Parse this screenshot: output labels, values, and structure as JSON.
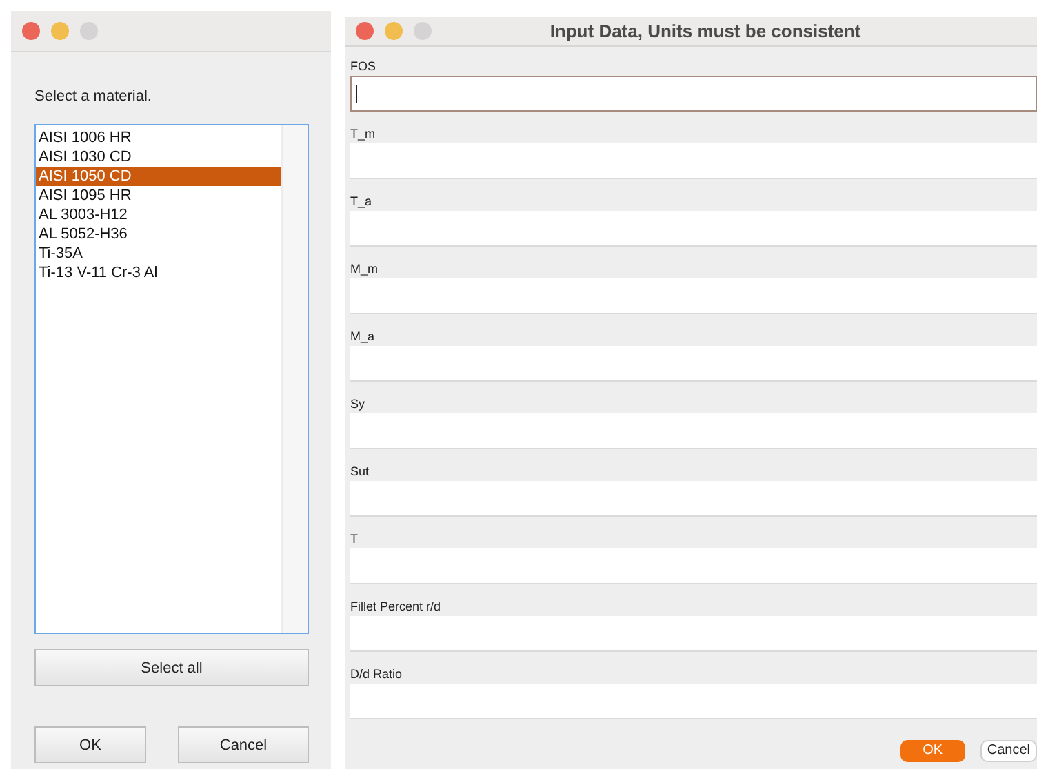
{
  "material_window": {
    "prompt": "Select a material.",
    "materials": [
      {
        "label": "AISI 1006 HR",
        "selected": false
      },
      {
        "label": "AISI 1030 CD",
        "selected": false
      },
      {
        "label": "AISI 1050 CD",
        "selected": true
      },
      {
        "label": "AISI 1095 HR",
        "selected": false
      },
      {
        "label": "AL 3003-H12",
        "selected": false
      },
      {
        "label": "AL 5052-H36",
        "selected": false
      },
      {
        "label": "Ti-35A",
        "selected": false
      },
      {
        "label": "Ti-13 V-11 Cr-3 Al",
        "selected": false
      }
    ],
    "select_all_button": "Select all",
    "buttons": [
      "OK",
      "Cancel"
    ]
  },
  "input_window": {
    "title": "Input Data, Units must be consistent",
    "fields": [
      {
        "label": "FOS",
        "focused": true
      },
      {
        "label": "T_m",
        "focused": false
      },
      {
        "label": "T_a",
        "focused": false
      },
      {
        "label": "M_m",
        "focused": false
      },
      {
        "label": "M_a",
        "focused": false
      },
      {
        "label": "Sy",
        "focused": false
      },
      {
        "label": "Sut",
        "focused": false
      },
      {
        "label": "T",
        "focused": false
      },
      {
        "label": "Fillet Percent r/d",
        "focused": false
      },
      {
        "label": "D/d Ratio",
        "focused": false
      }
    ],
    "buttons": [
      {
        "label": "OK",
        "kind": "default"
      },
      {
        "label": "Cancel",
        "kind": "normal"
      }
    ]
  }
}
